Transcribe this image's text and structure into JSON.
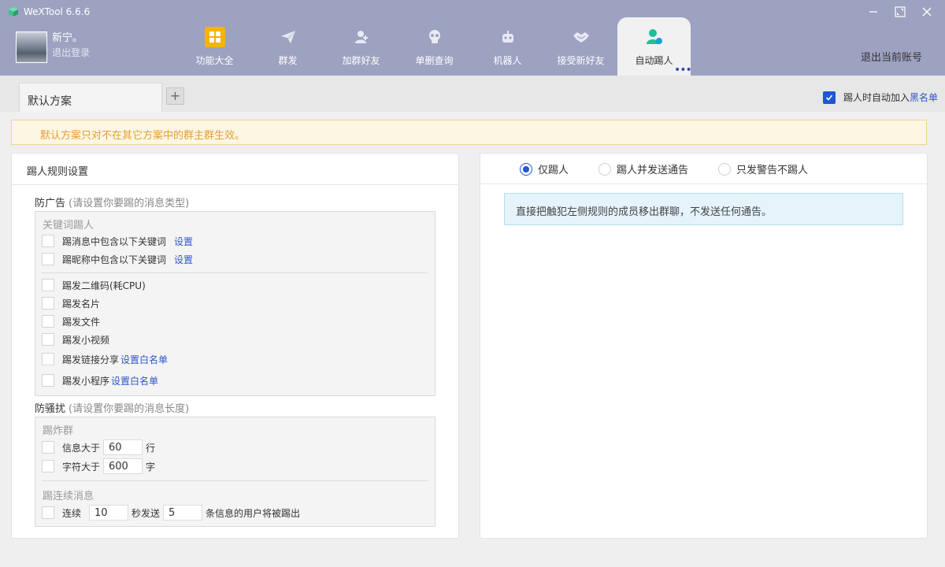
{
  "app": {
    "title": "WeXTool 6.6.6"
  },
  "user": {
    "name": "新宁。",
    "logout": "退出登录"
  },
  "nav": {
    "items": [
      {
        "label": "功能大全",
        "icon": "grid-icon"
      },
      {
        "label": "群发",
        "icon": "send-icon"
      },
      {
        "label": "加群好友",
        "icon": "add-user-icon"
      },
      {
        "label": "单删查询",
        "icon": "skull-icon"
      },
      {
        "label": "机器人",
        "icon": "robot-icon"
      },
      {
        "label": "接受新好友",
        "icon": "handshake-icon"
      },
      {
        "label": "自动踢人",
        "icon": "kick-user-icon"
      }
    ],
    "active_index": 6,
    "more_label": "•••"
  },
  "header": {
    "exit_account": "退出当前账号"
  },
  "tabs": {
    "items": [
      {
        "label": "默认方案"
      }
    ],
    "add_label": "+"
  },
  "auto_blacklist": {
    "label": "踢人时自动加入",
    "link": "黑名单",
    "checked": true
  },
  "notice": "默认方案只对不在其它方案中的群主群生效。",
  "left_panel": {
    "title": "踢人规则设置",
    "ad": {
      "title": "防广告",
      "hint": "(请设置你要踢的消息类型)",
      "keyword_group_label": "关键词踢人",
      "keyword_rows": [
        {
          "label": "踢消息中包含以下关键词",
          "link": "设置"
        },
        {
          "label": "踢昵称中包含以下关键词",
          "link": "设置"
        }
      ],
      "rows": [
        {
          "label": "踢发二维码(耗CPU)"
        },
        {
          "label": "踢发名片"
        },
        {
          "label": "踢发文件"
        },
        {
          "label": "踢发小视频"
        },
        {
          "label": "踢发链接分享",
          "link": "设置白名单"
        },
        {
          "label": "踢发小程序",
          "link": "设置白名单"
        }
      ]
    },
    "harass": {
      "title": "防骚扰",
      "hint": "(请设置你要踢的消息长度)",
      "bomb_label": "踢炸群",
      "msg_rows": [
        {
          "prefix": "信息大于",
          "value": "60",
          "suffix": "行"
        },
        {
          "prefix": "字符大于",
          "value": "600",
          "suffix": "字"
        }
      ],
      "continuous_label": "踢连续消息",
      "continuous": {
        "prefix": "连续",
        "seconds": "10",
        "mid": "秒发送",
        "count": "5",
        "suffix": "条信息的用户将被踢出"
      }
    }
  },
  "right_panel": {
    "options": [
      "仅踢人",
      "踢人并发送通告",
      "只发警告不踢人"
    ],
    "selected_index": 0,
    "description": "直接把触犯左侧规则的成员移出群聊，不发送任何通告。"
  },
  "colors": {
    "header_bg": "#9da2c1",
    "accent": "#1e56d6",
    "link": "#2f56c9",
    "notice_text": "#e5a032"
  }
}
